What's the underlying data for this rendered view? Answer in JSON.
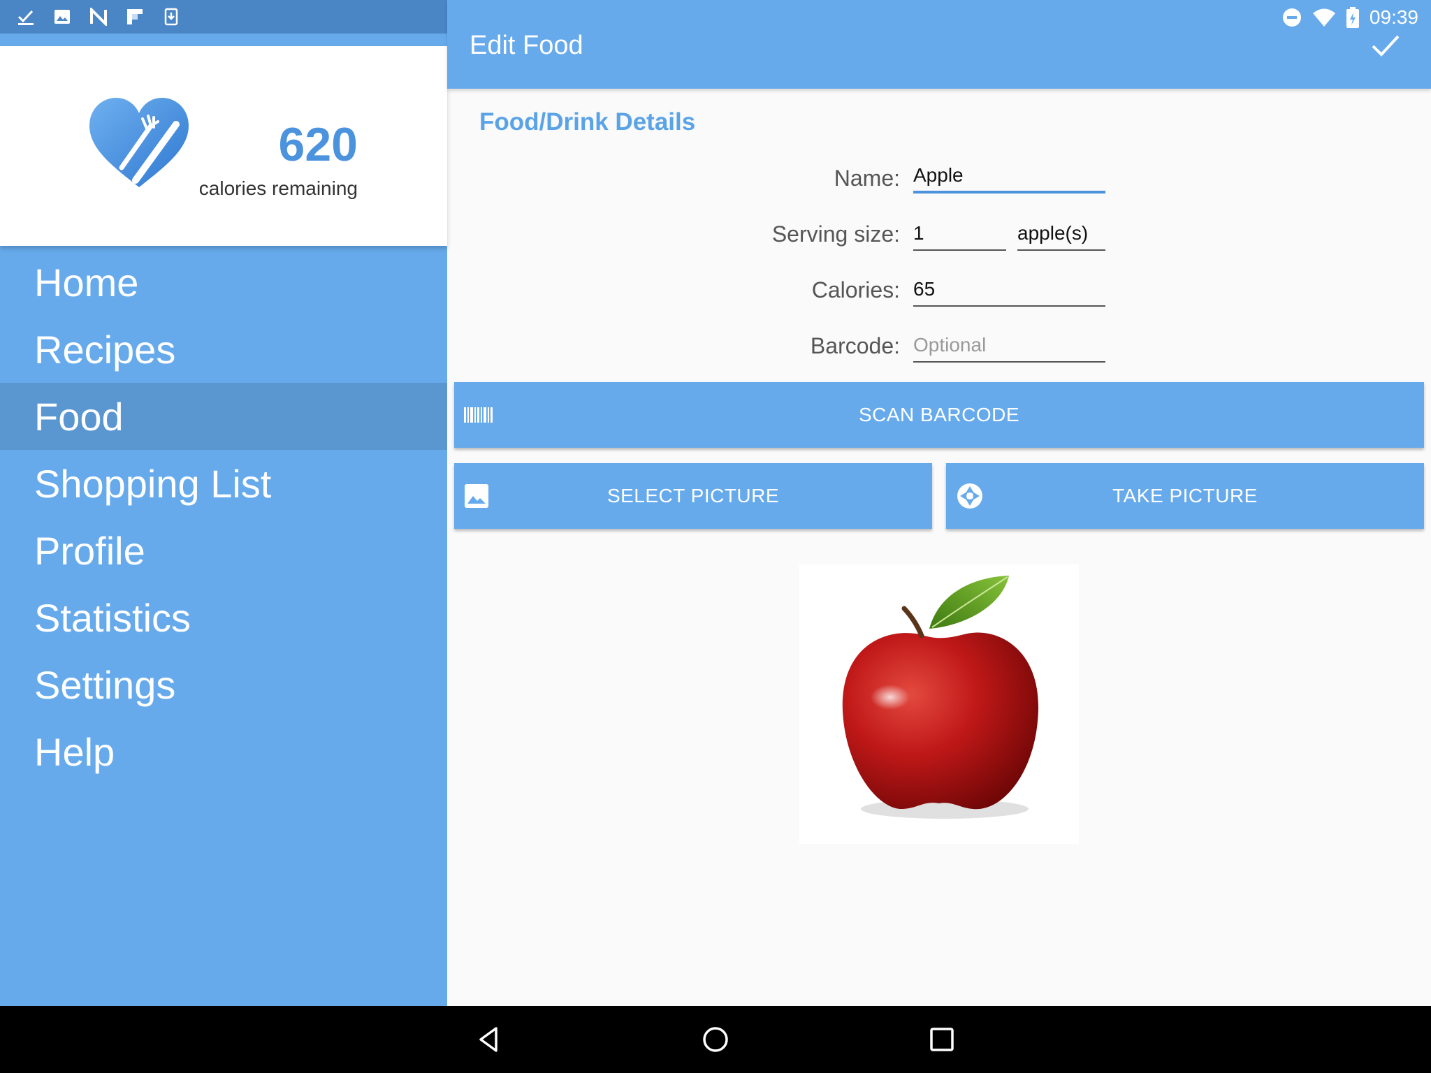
{
  "status_bar": {
    "time": "09:39",
    "left_icons": [
      "check-icon",
      "image-icon",
      "n-icon",
      "flipboard-icon",
      "download-icon"
    ],
    "right_icons": [
      "do-not-disturb-icon",
      "wifi-icon",
      "battery-icon"
    ]
  },
  "sidebar": {
    "calories_remaining": "620",
    "calories_label": "calories remaining",
    "items": [
      {
        "label": "Home"
      },
      {
        "label": "Recipes"
      },
      {
        "label": "Food",
        "active": true
      },
      {
        "label": "Shopping List"
      },
      {
        "label": "Profile"
      },
      {
        "label": "Statistics"
      },
      {
        "label": "Settings"
      },
      {
        "label": "Help"
      }
    ]
  },
  "appbar": {
    "title": "Edit Food",
    "action_icon": "check-icon"
  },
  "form": {
    "section_title": "Food/Drink Details",
    "name_label": "Name:",
    "name_value": "Apple",
    "serving_label": "Serving size:",
    "serving_value": "1",
    "serving_unit": "apple(s)",
    "calories_label": "Calories:",
    "calories_value": "65",
    "barcode_label": "Barcode:",
    "barcode_value": "",
    "barcode_placeholder": "Optional"
  },
  "buttons": {
    "scan_barcode": "SCAN BARCODE",
    "select_picture": "SELECT PICTURE",
    "take_picture": "TAKE PICTURE"
  },
  "image": {
    "subject": "apple-photo"
  },
  "colors": {
    "primary": "#66aaec",
    "primary_dark": "#4a86c6",
    "active_item": "#5a96d0",
    "accent_text": "#4b93dd"
  }
}
